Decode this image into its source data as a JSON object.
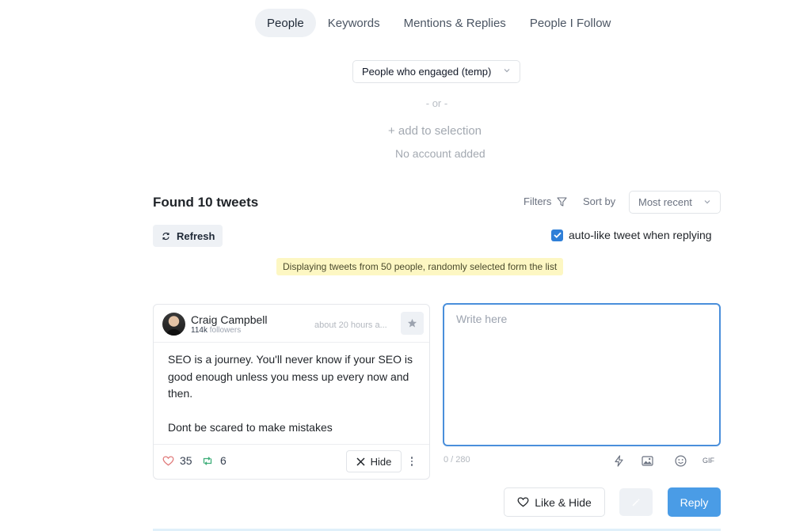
{
  "tabs": [
    {
      "label": "People",
      "active": true
    },
    {
      "label": "Keywords",
      "active": false
    },
    {
      "label": "Mentions & Replies",
      "active": false
    },
    {
      "label": "People I Follow",
      "active": false
    }
  ],
  "source": {
    "selected": "People who engaged (temp)"
  },
  "or_text": "- or -",
  "add_selection": "+ add to selection",
  "no_account": "No account added",
  "results": {
    "title": "Found 10 tweets",
    "filters_label": "Filters",
    "sort_label": "Sort by",
    "sort_selected": "Most recent",
    "refresh_label": "Refresh",
    "autolike_label": "auto-like tweet when replying",
    "autolike_checked": true,
    "notice": "Displaying tweets from 50 people, randomly selected form the list"
  },
  "tweet": {
    "author": "Craig Campbell",
    "followers_count": "114k",
    "followers_label": "followers",
    "time": "about 20 hours a...",
    "text_lines": [
      "SEO is a journey. You'll never know if your SEO is good enough unless you mess up every now and then.",
      "Dont be scared to make mistakes"
    ],
    "likes": "35",
    "retweets": "6",
    "hide_label": "Hide"
  },
  "reply": {
    "placeholder": "Write here",
    "char_count": "0 / 280",
    "gif_label": "GIF",
    "like_hide_label": "Like & Hide",
    "reply_label": "Reply"
  },
  "colors": {
    "accent": "#4a9ce6",
    "checkbox": "#2f7fd8",
    "notice_bg": "#fdf7c3",
    "like_icon": "#e07a7a",
    "retweet_icon": "#3fae7a"
  }
}
